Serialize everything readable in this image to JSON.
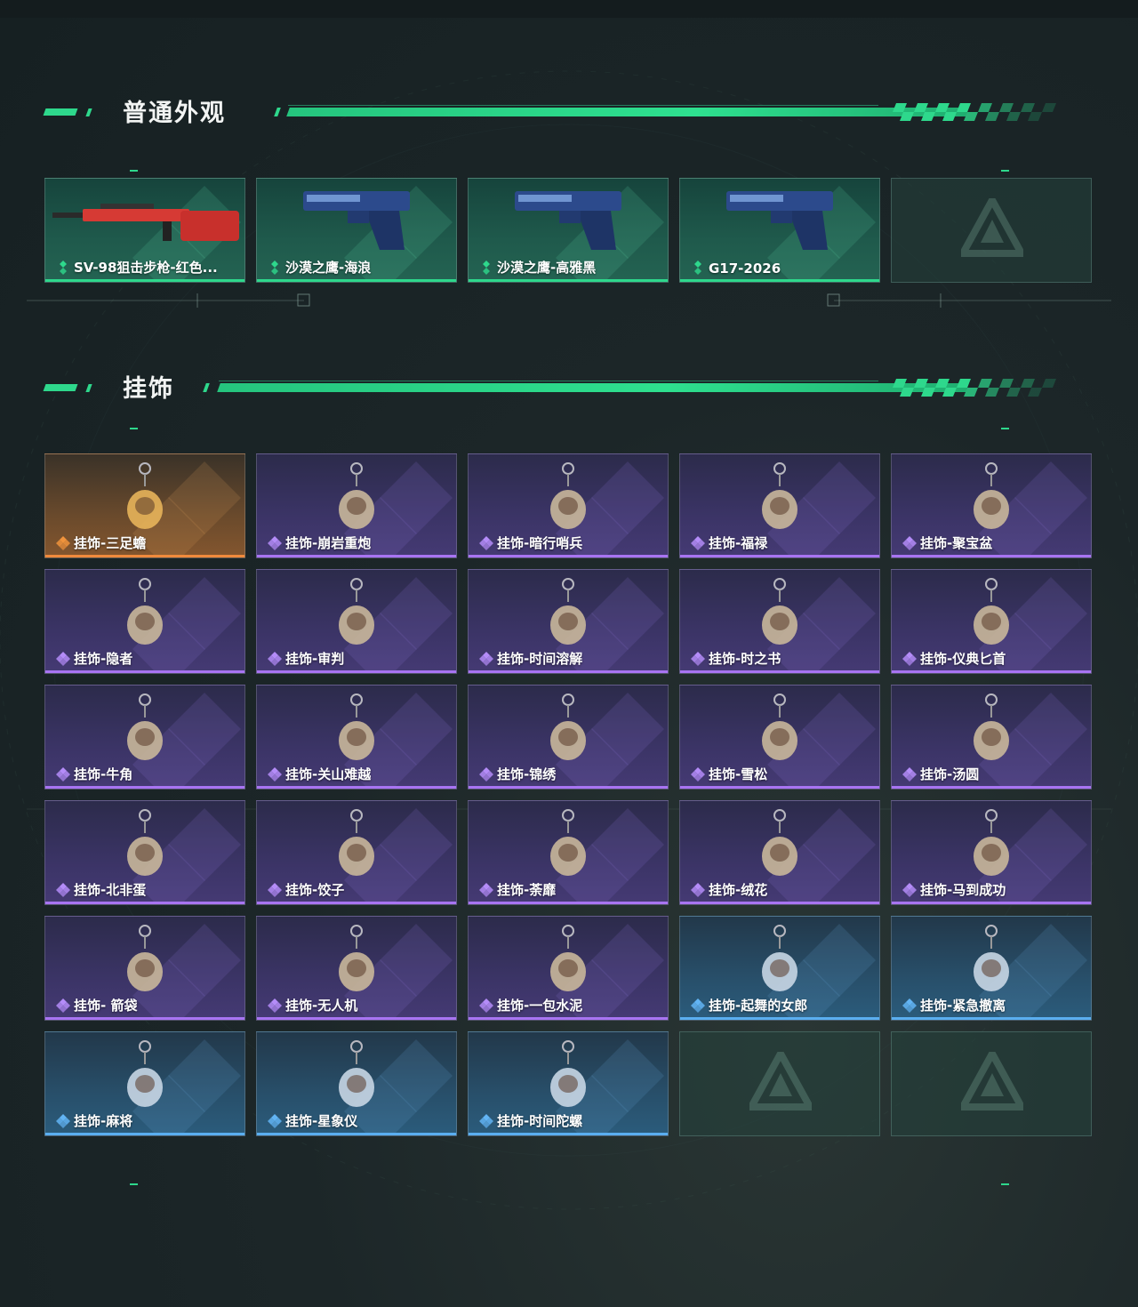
{
  "sections": [
    {
      "title": "普通外观",
      "items": [
        {
          "label": "SV-98狙击步枪-红色...",
          "rarity": "green",
          "icon": "sniper-rifle-icon"
        },
        {
          "label": "沙漠之鹰-海浪",
          "rarity": "green",
          "icon": "pistol-icon"
        },
        {
          "label": "沙漠之鹰-高雅黑",
          "rarity": "green",
          "icon": "pistol-icon"
        },
        {
          "label": "G17-2026",
          "rarity": "green",
          "icon": "pistol-icon"
        },
        {
          "label": "",
          "rarity": "empty",
          "icon": "game-logo-icon"
        }
      ]
    },
    {
      "title": "挂饰",
      "items": [
        {
          "label": "挂饰-三足蟾",
          "rarity": "orange",
          "icon": "charm-toad-icon"
        },
        {
          "label": "挂饰-崩岩重炮",
          "rarity": "purple",
          "icon": "charm-figure-icon"
        },
        {
          "label": "挂饰-暗行哨兵",
          "rarity": "purple",
          "icon": "charm-figure-icon"
        },
        {
          "label": "挂饰-福禄",
          "rarity": "purple",
          "icon": "charm-gourd-icon"
        },
        {
          "label": "挂饰-聚宝盆",
          "rarity": "purple",
          "icon": "charm-bowl-icon"
        },
        {
          "label": "挂饰-隐者",
          "rarity": "purple",
          "icon": "charm-card-icon"
        },
        {
          "label": "挂饰-审判",
          "rarity": "purple",
          "icon": "charm-card-icon"
        },
        {
          "label": "挂饰-时间溶解",
          "rarity": "purple",
          "icon": "charm-clock-icon"
        },
        {
          "label": "挂饰-时之书",
          "rarity": "purple",
          "icon": "charm-book-icon"
        },
        {
          "label": "挂饰-仪典匕首",
          "rarity": "purple",
          "icon": "charm-dagger-icon"
        },
        {
          "label": "挂饰-牛角",
          "rarity": "purple",
          "icon": "charm-horns-icon"
        },
        {
          "label": "挂饰-关山难越",
          "rarity": "purple",
          "icon": "charm-cylinder-icon"
        },
        {
          "label": "挂饰-锦绣",
          "rarity": "purple",
          "icon": "charm-butterfly-icon"
        },
        {
          "label": "挂饰-雪松",
          "rarity": "purple",
          "icon": "charm-tree-icon"
        },
        {
          "label": "挂饰-汤圆",
          "rarity": "purple",
          "icon": "charm-bowl-icon"
        },
        {
          "label": "挂饰-北非蛋",
          "rarity": "purple",
          "icon": "charm-plate-icon"
        },
        {
          "label": "挂饰-饺子",
          "rarity": "purple",
          "icon": "charm-plate-icon"
        },
        {
          "label": "挂饰-荼靡",
          "rarity": "purple",
          "icon": "charm-flower-icon"
        },
        {
          "label": "挂饰-绒花",
          "rarity": "purple",
          "icon": "charm-flower-icon"
        },
        {
          "label": "挂饰-马到成功",
          "rarity": "purple",
          "icon": "charm-horse-icon"
        },
        {
          "label": "挂饰- 箭袋",
          "rarity": "purple",
          "icon": "charm-quiver-icon"
        },
        {
          "label": "挂饰-无人机",
          "rarity": "purple",
          "icon": "charm-drone-icon"
        },
        {
          "label": "挂饰-一包水泥",
          "rarity": "purple",
          "icon": "charm-bag-icon"
        },
        {
          "label": "挂饰-起舞的女郎",
          "rarity": "blue",
          "icon": "charm-dancer-icon"
        },
        {
          "label": "挂饰-紧急撤离",
          "rarity": "blue",
          "icon": "charm-sign-icon"
        },
        {
          "label": "挂饰-麻将",
          "rarity": "blue",
          "icon": "charm-mahjong-icon"
        },
        {
          "label": "挂饰-星象仪",
          "rarity": "blue",
          "icon": "charm-astrolabe-icon"
        },
        {
          "label": "挂饰-时间陀螺",
          "rarity": "blue",
          "icon": "charm-top-icon"
        },
        {
          "label": "",
          "rarity": "empty",
          "icon": "game-logo-icon"
        },
        {
          "label": "",
          "rarity": "empty",
          "icon": "game-logo-icon"
        }
      ]
    }
  ],
  "colors": {
    "accent": "#2ed88c",
    "green_rarity": "#2ed88c",
    "purple_rarity": "#a874f2",
    "orange_rarity": "#f08a3c",
    "blue_rarity": "#5aaef0"
  }
}
